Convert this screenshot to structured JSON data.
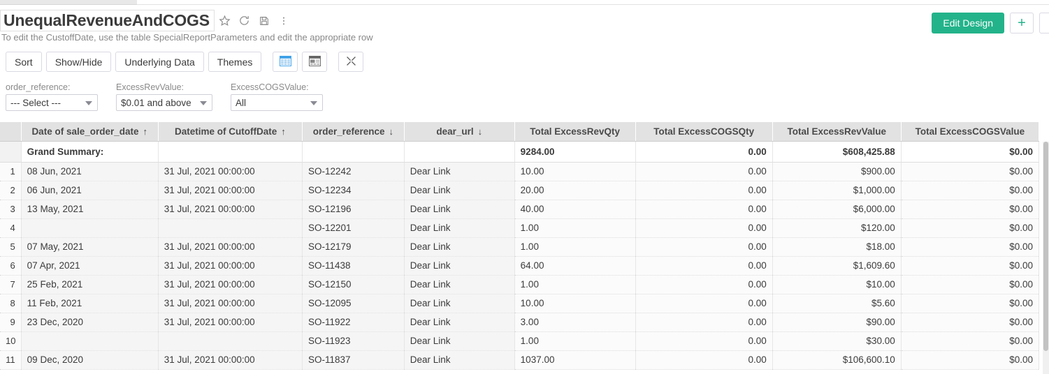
{
  "header": {
    "title": "UnequalRevenueAndCOGS",
    "subtitle": "To edit the CustoffDate, use the table SpecialReportParameters and edit the appropriate row",
    "icons": {
      "favorite": "star-icon",
      "refresh": "refresh-icon",
      "save": "save-icon",
      "more": "more-vertical-icon"
    },
    "edit_design_label": "Edit Design",
    "add_label": "+",
    "accent_color": "#23b38a"
  },
  "toolbar": {
    "buttons": [
      {
        "label": "Sort",
        "name": "sort-button"
      },
      {
        "label": "Show/Hide",
        "name": "show-hide-button"
      },
      {
        "label": "Underlying Data",
        "name": "underlying-data-button"
      },
      {
        "label": "Themes",
        "name": "themes-button"
      }
    ],
    "icon_buttons": [
      {
        "name": "grid-view-icon",
        "active": true
      },
      {
        "name": "summary-view-icon",
        "active": false
      },
      {
        "name": "collapse-icon",
        "active": false
      }
    ]
  },
  "filters": [
    {
      "label": "order_reference:",
      "value": "--- Select ---",
      "name": "filter-order-reference"
    },
    {
      "label": "ExcessRevValue:",
      "value": "$0.01 and above",
      "name": "filter-excess-rev-value"
    },
    {
      "label": "ExcessCOGSValue:",
      "value": "All",
      "name": "filter-excess-cogs-value"
    }
  ],
  "table": {
    "columns": [
      {
        "label": "Date of sale_order_date",
        "sort": "up",
        "align": "center"
      },
      {
        "label": "Datetime of CutoffDate",
        "sort": "up",
        "align": "center"
      },
      {
        "label": "order_reference",
        "sort": "down",
        "align": "center"
      },
      {
        "label": "dear_url",
        "sort": "down",
        "align": "center"
      },
      {
        "label": "Total ExcessRevQty",
        "sort": "",
        "align": "center"
      },
      {
        "label": "Total ExcessCOGSQty",
        "sort": "",
        "align": "center"
      },
      {
        "label": "Total ExcessRevValue",
        "sort": "",
        "align": "center"
      },
      {
        "label": "Total ExcessCOGSValue",
        "sort": "",
        "align": "center"
      }
    ],
    "summary": {
      "label": "Grand Summary:",
      "excess_rev_qty": "9284.00",
      "excess_cogs_qty": "0.00",
      "excess_rev_value": "$608,425.88",
      "excess_cogs_value": "$0.00"
    },
    "rows": [
      {
        "n": "1",
        "sale_order_date": "08 Jun, 2021",
        "cutoff_date": "31 Jul, 2021 00:00:00",
        "order_reference": "SO-12242",
        "dear_url": "Dear Link",
        "excess_rev_qty": "10.00",
        "excess_cogs_qty": "0.00",
        "excess_rev_value": "$900.00",
        "excess_cogs_value": "$0.00",
        "indent": false
      },
      {
        "n": "2",
        "sale_order_date": "06 Jun, 2021",
        "cutoff_date": "31 Jul, 2021 00:00:00",
        "order_reference": "SO-12234",
        "dear_url": "Dear Link",
        "excess_rev_qty": "20.00",
        "excess_cogs_qty": "0.00",
        "excess_rev_value": "$1,000.00",
        "excess_cogs_value": "$0.00",
        "indent": false
      },
      {
        "n": "3",
        "sale_order_date": "13 May, 2021",
        "cutoff_date": "31 Jul, 2021 00:00:00",
        "order_reference": "SO-12196",
        "dear_url": "Dear Link",
        "excess_rev_qty": "40.00",
        "excess_cogs_qty": "0.00",
        "excess_rev_value": "$6,000.00",
        "excess_cogs_value": "$0.00",
        "indent": true
      },
      {
        "n": "4",
        "sale_order_date": "",
        "cutoff_date": "",
        "order_reference": "SO-12201",
        "dear_url": "Dear Link",
        "excess_rev_qty": "1.00",
        "excess_cogs_qty": "0.00",
        "excess_rev_value": "$120.00",
        "excess_cogs_value": "$0.00",
        "indent": false
      },
      {
        "n": "5",
        "sale_order_date": "07 May, 2021",
        "cutoff_date": "31 Jul, 2021 00:00:00",
        "order_reference": "SO-12179",
        "dear_url": "Dear Link",
        "excess_rev_qty": "1.00",
        "excess_cogs_qty": "0.00",
        "excess_rev_value": "$18.00",
        "excess_cogs_value": "$0.00",
        "indent": false
      },
      {
        "n": "6",
        "sale_order_date": "07 Apr, 2021",
        "cutoff_date": "31 Jul, 2021 00:00:00",
        "order_reference": "SO-11438",
        "dear_url": "Dear Link",
        "excess_rev_qty": "64.00",
        "excess_cogs_qty": "0.00",
        "excess_rev_value": "$1,609.60",
        "excess_cogs_value": "$0.00",
        "indent": false
      },
      {
        "n": "7",
        "sale_order_date": "25 Feb, 2021",
        "cutoff_date": "31 Jul, 2021 00:00:00",
        "order_reference": "SO-12150",
        "dear_url": "Dear Link",
        "excess_rev_qty": "1.00",
        "excess_cogs_qty": "0.00",
        "excess_rev_value": "$10.00",
        "excess_cogs_value": "$0.00",
        "indent": false
      },
      {
        "n": "8",
        "sale_order_date": "11 Feb, 2021",
        "cutoff_date": "31 Jul, 2021 00:00:00",
        "order_reference": "SO-12095",
        "dear_url": "Dear Link",
        "excess_rev_qty": "10.00",
        "excess_cogs_qty": "0.00",
        "excess_rev_value": "$5.60",
        "excess_cogs_value": "$0.00",
        "indent": false
      },
      {
        "n": "9",
        "sale_order_date": "23 Dec, 2020",
        "cutoff_date": "31 Jul, 2021 00:00:00",
        "order_reference": "SO-11922",
        "dear_url": "Dear Link",
        "excess_rev_qty": "3.00",
        "excess_cogs_qty": "0.00",
        "excess_rev_value": "$90.00",
        "excess_cogs_value": "$0.00",
        "indent": false
      },
      {
        "n": "10",
        "sale_order_date": "",
        "cutoff_date": "",
        "order_reference": "SO-11923",
        "dear_url": "Dear Link",
        "excess_rev_qty": "1.00",
        "excess_cogs_qty": "0.00",
        "excess_rev_value": "$30.00",
        "excess_cogs_value": "$0.00",
        "indent": false
      },
      {
        "n": "11",
        "sale_order_date": "09 Dec, 2020",
        "cutoff_date": "31 Jul, 2021 00:00:00",
        "order_reference": "SO-11837",
        "dear_url": "Dear Link",
        "excess_rev_qty": "1037.00",
        "excess_cogs_qty": "0.00",
        "excess_rev_value": "$106,600.10",
        "excess_cogs_value": "$0.00",
        "indent": false
      }
    ]
  }
}
